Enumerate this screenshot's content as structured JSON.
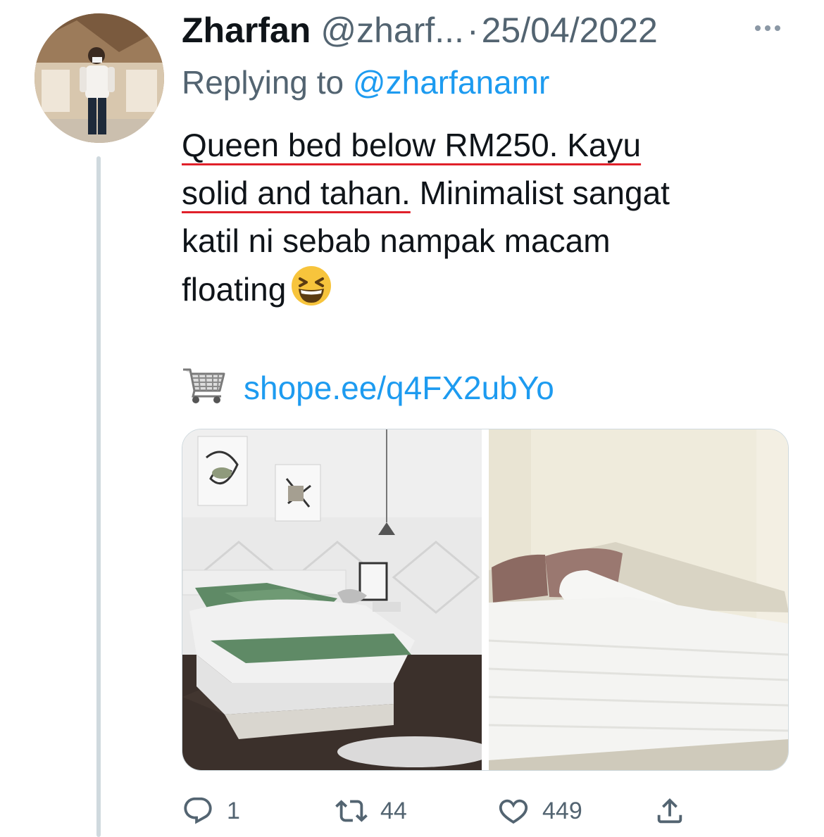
{
  "tweet": {
    "author_name": "Zharfan",
    "author_handle": "@zharf...",
    "separator": "·",
    "date": "25/04/2022",
    "replying_prefix": "Replying to",
    "replying_to": "@zharfanamr",
    "text_lines": [
      [
        "Queen bed below RM250. Kayu",
        ""
      ],
      [
        "solid and tahan.",
        " Minimalist sangat"
      ],
      [
        "katil ni sebab nampak macam",
        ""
      ],
      [
        "floating",
        ""
      ]
    ],
    "emoji": "grinning-squinting-face-emoji",
    "link_icon": "shopping-cart-icon",
    "link_text": "shope.ee/q4FX2ubYo",
    "media": [
      {
        "alt_icon": "bed-photo-green-bedding"
      },
      {
        "alt_icon": "bed-photo-white-bedding"
      }
    ],
    "actions": {
      "reply_count": "1",
      "retweet_count": "44",
      "like_count": "449"
    }
  },
  "colors": {
    "text": "#0f1419",
    "muted": "#536471",
    "link": "#1d9bf0",
    "spellcheck": "#e0202a",
    "thread_line": "#cfd9de"
  }
}
